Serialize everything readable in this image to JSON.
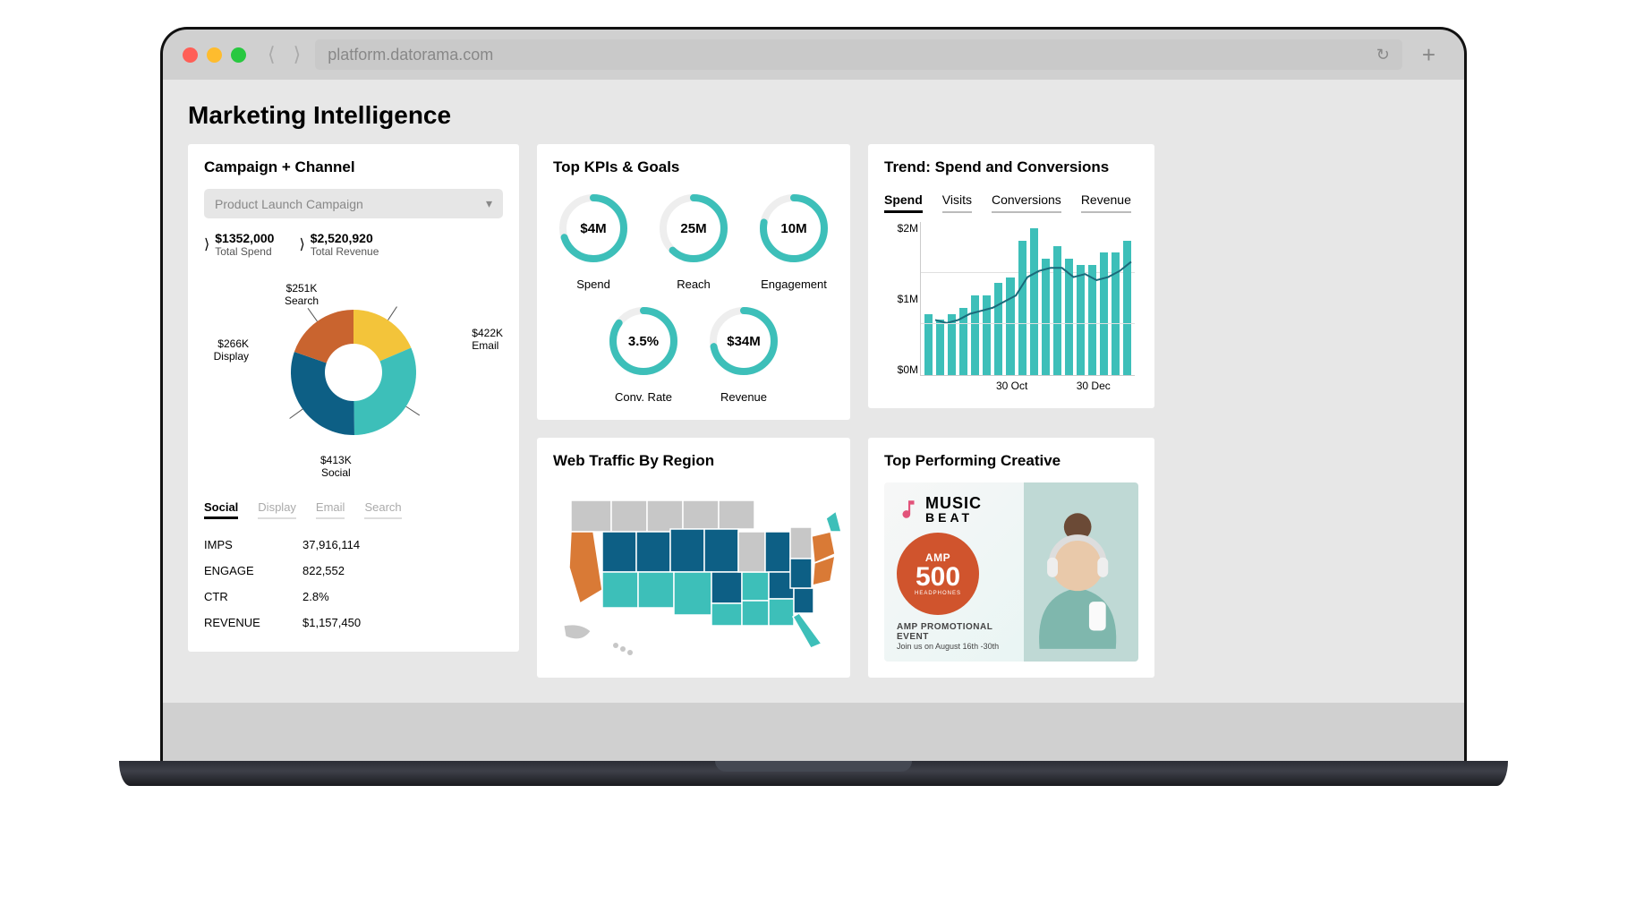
{
  "browser": {
    "url": "platform.datorama.com"
  },
  "page": {
    "title": "Marketing Intelligence"
  },
  "kpi": {
    "title": "Top KPIs & Goals",
    "items": [
      {
        "value": "$4M",
        "label": "Spend",
        "pct": 70
      },
      {
        "value": "25M",
        "label": "Reach",
        "pct": 62
      },
      {
        "value": "10M",
        "label": "Engagement",
        "pct": 78
      },
      {
        "value": "3.5%",
        "label": "Conv. Rate",
        "pct": 85
      },
      {
        "value": "$34M",
        "label": "Revenue",
        "pct": 72
      }
    ]
  },
  "trend": {
    "title": "Trend: Spend and Conversions",
    "tabs": [
      "Spend",
      "Visits",
      "Conversions",
      "Revenue"
    ],
    "active_tab": "Spend",
    "ylabels": [
      "$2M",
      "$1M",
      "$0M"
    ],
    "xlabels": [
      "",
      "30 Oct",
      "30 Dec"
    ]
  },
  "campaign": {
    "title": "Campaign + Channel",
    "dropdown": "Product Launch Campaign",
    "totals": [
      {
        "value": "$1352,000",
        "label": "Total Spend"
      },
      {
        "value": "$2,520,920",
        "label": "Total Revenue"
      }
    ],
    "donut_labels": [
      {
        "txt": "$251K\nSearch"
      },
      {
        "txt": "$422K\nEmail"
      },
      {
        "txt": "$266K\nDisplay"
      },
      {
        "txt": "$413K\nSocial"
      }
    ],
    "channel_tabs": [
      "Social",
      "Display",
      "Email",
      "Search"
    ],
    "active_channel": "Social",
    "metrics": [
      {
        "k": "IMPS",
        "v": "37,916,114"
      },
      {
        "k": "ENGAGE",
        "v": "822,552"
      },
      {
        "k": "CTR",
        "v": "2.8%"
      },
      {
        "k": "REVENUE",
        "v": "$1,157,450"
      }
    ]
  },
  "traffic": {
    "title": "Web Traffic By Region"
  },
  "creative": {
    "title": "Top Performing Creative",
    "brand_top": "MUSIC",
    "brand_bottom": "BEAT",
    "badge_top": "AMP",
    "badge_num": "500",
    "badge_sub": "HEADPHONES",
    "promo_head": "AMP PROMOTIONAL EVENT",
    "promo_sub": "Join us on August 16th -30th"
  },
  "chart_data": [
    {
      "type": "bar",
      "title": "Trend: Spend and Conversions",
      "series": [
        {
          "name": "Spend bars",
          "values": [
            1.0,
            0.9,
            1.0,
            1.1,
            1.3,
            1.3,
            1.5,
            1.6,
            2.2,
            2.4,
            1.9,
            2.1,
            1.9,
            1.8,
            1.8,
            2.0,
            2.0,
            2.2
          ]
        },
        {
          "name": "Trend line",
          "values": [
            0.9,
            0.85,
            0.9,
            1.0,
            1.05,
            1.1,
            1.2,
            1.3,
            1.6,
            1.7,
            1.75,
            1.75,
            1.6,
            1.65,
            1.55,
            1.6,
            1.7,
            1.85
          ]
        }
      ],
      "ylabel": "",
      "xlabel": "",
      "ylim": [
        0,
        2.5
      ],
      "categories": [
        "",
        "",
        "",
        "",
        "",
        "",
        "",
        "",
        "",
        "30 Oct",
        "",
        "",
        "",
        "",
        "",
        "",
        "",
        "30 Dec"
      ]
    },
    {
      "type": "pie",
      "title": "Campaign + Channel spend breakdown",
      "categories": [
        "Search",
        "Email",
        "Social",
        "Display"
      ],
      "values": [
        251,
        422,
        413,
        266
      ],
      "colors": [
        "#f3c43a",
        "#3dbfb9",
        "#0d5f85",
        "#c9642f"
      ]
    },
    {
      "type": "bar",
      "title": "Top KPIs & Goals (gauge completion %)",
      "categories": [
        "Spend",
        "Reach",
        "Engagement",
        "Conv. Rate",
        "Revenue"
      ],
      "values": [
        70,
        62,
        78,
        85,
        72
      ],
      "ylim": [
        0,
        100
      ]
    }
  ]
}
